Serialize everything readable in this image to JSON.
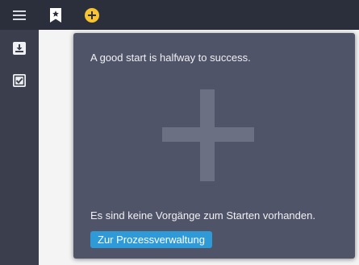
{
  "topbar": {
    "icons": {
      "menu": "hamburger-menu-icon",
      "bookmark": "bookmark-star-icon",
      "add": "plus-circle-icon"
    },
    "colors": {
      "background": "#2b2e3b",
      "add_accent": "#f7c331"
    }
  },
  "sidebar": {
    "items": [
      {
        "icon": "inbox-download-icon"
      },
      {
        "icon": "checkbox-task-icon"
      }
    ]
  },
  "popover": {
    "headline": "A good start is halfway to success.",
    "empty_message": "Es sind keine Vorgänge zum Starten vorhanden.",
    "cta_label": "Zur Prozessverwaltung",
    "colors": {
      "background": "#505468",
      "cta": "#2e9ad8"
    }
  }
}
